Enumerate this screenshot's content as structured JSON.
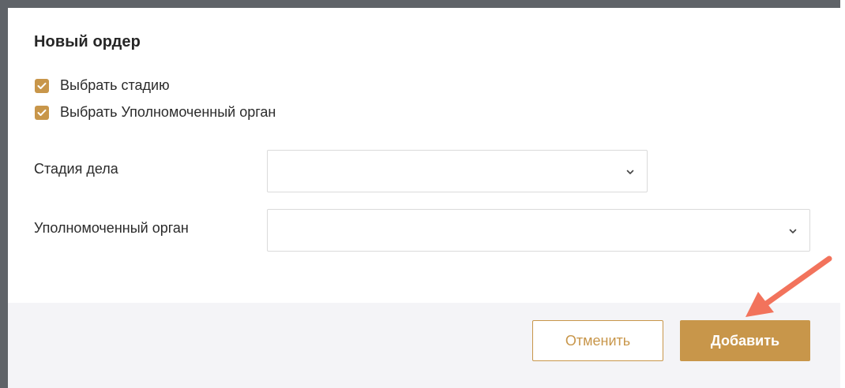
{
  "modal": {
    "title": "Новый ордер"
  },
  "options": [
    {
      "label": "Выбрать стадию",
      "checked": true
    },
    {
      "label": "Выбрать Уполномоченный орган",
      "checked": true
    }
  ],
  "fields": {
    "stage": {
      "label": "Стадия дела",
      "value": ""
    },
    "authority": {
      "label": "Уполномоченный орган",
      "value": ""
    }
  },
  "buttons": {
    "cancel": "Отменить",
    "add": "Добавить"
  },
  "colors": {
    "accent": "#c8964a",
    "annotation_arrow": "#f2735c",
    "footer_bg": "#f4f4f7"
  },
  "icons": {
    "checkbox": "checkmark-icon",
    "select": "chevron-down-icon",
    "annotation": "arrow-annotation-icon"
  }
}
